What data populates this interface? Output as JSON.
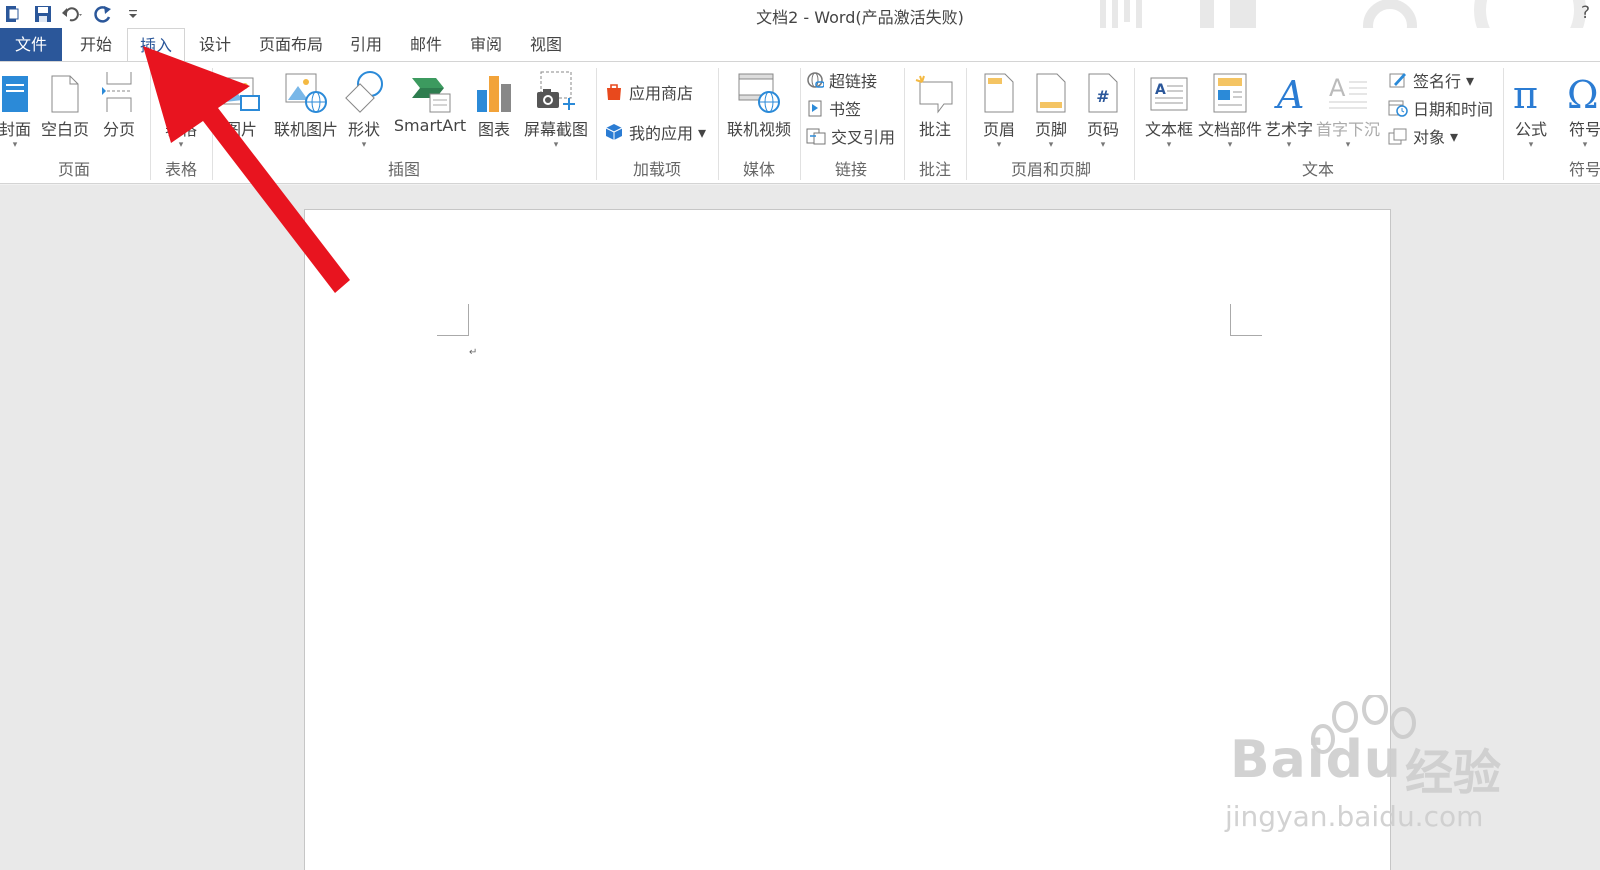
{
  "window": {
    "title": "文档2 - Word(产品激活失败)",
    "help": "?"
  },
  "tabs": [
    {
      "label": "文件"
    },
    {
      "label": "开始"
    },
    {
      "label": "插入"
    },
    {
      "label": "设计"
    },
    {
      "label": "页面布局"
    },
    {
      "label": "引用"
    },
    {
      "label": "邮件"
    },
    {
      "label": "审阅"
    },
    {
      "label": "视图"
    }
  ],
  "active_tab": "插入",
  "ribbon": {
    "pages": {
      "group": "页面",
      "cover": "封面",
      "blank": "空白页",
      "break": "分页"
    },
    "tables": {
      "group": "表格",
      "table": "表格"
    },
    "illustrations": {
      "group": "插图",
      "picture": "图片",
      "online_picture": "联机图片",
      "shapes": "形状",
      "smartart": "SmartArt",
      "chart": "图表",
      "screenshot": "屏幕截图"
    },
    "addins": {
      "group": "加载项",
      "store": "应用商店",
      "my_apps": "我的应用"
    },
    "media": {
      "group": "媒体",
      "online_video": "联机视频"
    },
    "links": {
      "group": "链接",
      "hyperlink": "超链接",
      "bookmark": "书签",
      "cross_ref": "交叉引用"
    },
    "comments": {
      "group": "批注",
      "comment": "批注"
    },
    "header_footer": {
      "group": "页眉和页脚",
      "header": "页眉",
      "footer": "页脚",
      "page_number": "页码"
    },
    "text": {
      "group": "文本",
      "textbox": "文本框",
      "quick_parts": "文档部件",
      "wordart": "艺术字",
      "dropcap": "首字下沉",
      "signature": "签名行",
      "datetime": "日期和时间",
      "object": "对象"
    },
    "symbols": {
      "group": "符号",
      "equation": "公式",
      "symbol": "符号"
    }
  },
  "document": {
    "paragraph_mark": "↵"
  },
  "watermark": {
    "brand": "Bai",
    "brand2": "du",
    "cn": "经验",
    "url": "jingyan.baidu.com"
  },
  "colors": {
    "accent": "#2b579a",
    "arrow": "#e8141f"
  }
}
